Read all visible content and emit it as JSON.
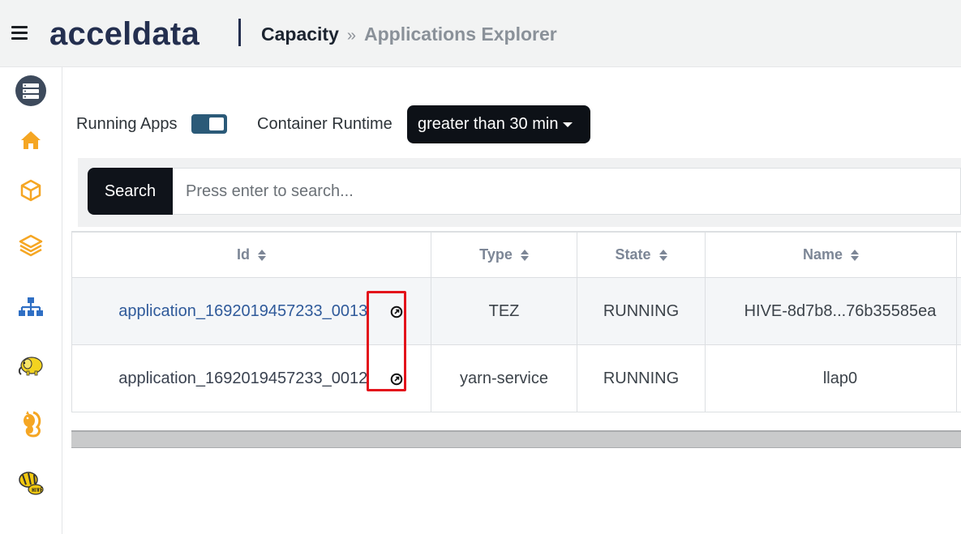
{
  "header": {
    "logo_text": "acceldata",
    "breadcrumb_current": "Capacity",
    "breadcrumb_separator": "»",
    "breadcrumb_page": "Applications Explorer"
  },
  "sidebar": {
    "items": [
      {
        "icon": "server-stack-icon",
        "color": "#3d4a5c"
      },
      {
        "icon": "home-icon",
        "color": "#f5a623"
      },
      {
        "icon": "cube-icon",
        "color": "#f5a623"
      },
      {
        "icon": "layers-icon",
        "color": "#f5a623"
      },
      {
        "icon": "sitemap-icon",
        "color": "#2f6fc4"
      },
      {
        "icon": "hadoop-elephant-icon",
        "color": "#f3d320"
      },
      {
        "icon": "hadoop-squirrel-icon",
        "color": "#f5a623"
      },
      {
        "icon": "hive-bee-icon",
        "color": "#f3c90f"
      }
    ]
  },
  "filters": {
    "running_apps_label": "Running Apps",
    "running_apps_enabled": true,
    "container_runtime_label": "Container Runtime",
    "container_runtime_value": "greater than 30 min"
  },
  "search": {
    "button_label": "Search",
    "placeholder": "Press enter to search..."
  },
  "table": {
    "columns": [
      "Id",
      "Type",
      "State",
      "Name"
    ],
    "rows": [
      {
        "id": "application_1692019457233_0013",
        "type": "TEZ",
        "state": "RUNNING",
        "name": "HIVE-8d7b8...76b35585ea"
      },
      {
        "id": "application_1692019457233_0012",
        "type": "yarn-service",
        "state": "RUNNING",
        "name": "llap0"
      }
    ]
  },
  "colors": {
    "accent": "#2b5a78",
    "brand": "#242f4f",
    "highlight_box": "#e3131b",
    "link": "#2f5a9a"
  }
}
